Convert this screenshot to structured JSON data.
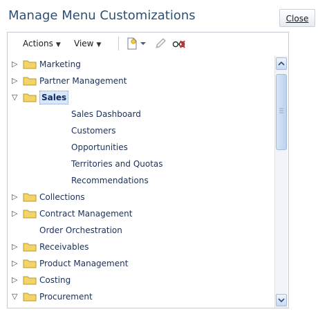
{
  "dialog": {
    "title": "Manage Menu Customizations",
    "close_label": "Close"
  },
  "toolbar": {
    "actions_label": "Actions",
    "view_label": "View",
    "icons": [
      "new-icon",
      "chevron-down-icon",
      "edit-pencil-icon",
      "hide-glasses-icon"
    ]
  },
  "tree": [
    {
      "label": "Marketing",
      "expanded": false,
      "folder": true
    },
    {
      "label": "Partner Management",
      "expanded": false,
      "folder": true
    },
    {
      "label": "Sales",
      "expanded": true,
      "folder": true,
      "selected": true
    },
    {
      "label": "Sales Dashboard",
      "folder": false
    },
    {
      "label": "Customers",
      "folder": false
    },
    {
      "label": "Opportunities",
      "folder": false
    },
    {
      "label": "Territories and Quotas",
      "folder": false
    },
    {
      "label": "Recommendations",
      "folder": false
    },
    {
      "label": "Collections",
      "expanded": false,
      "folder": true
    },
    {
      "label": "Contract Management",
      "expanded": false,
      "folder": true
    },
    {
      "label": "Order Orchestration",
      "folder": false
    },
    {
      "label": "Receivables",
      "expanded": false,
      "folder": true
    },
    {
      "label": "Product Management",
      "expanded": false,
      "folder": true
    },
    {
      "label": "Costing",
      "expanded": false,
      "folder": true
    },
    {
      "label": "Procurement",
      "expanded": true,
      "folder": true
    }
  ],
  "colors": {
    "title": "#2d4f73",
    "folder": "#f2d46b",
    "selection": "#dbe7f6"
  }
}
